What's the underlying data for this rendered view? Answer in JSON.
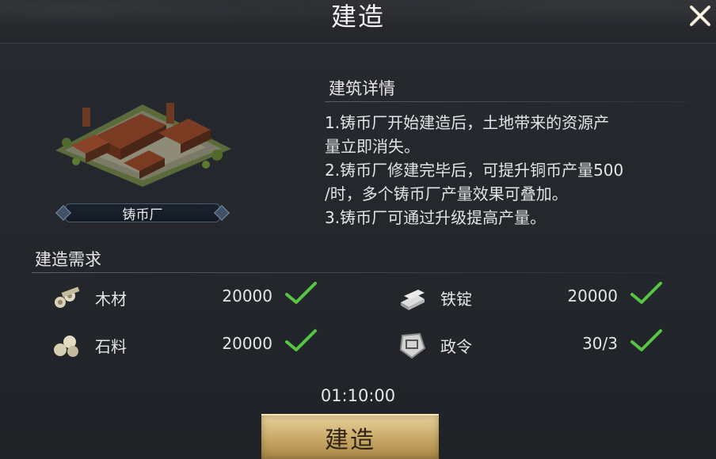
{
  "header": {
    "title": "建造",
    "close_icon": "close-x-icon"
  },
  "building": {
    "name": "铸币厂",
    "image_icon": "mint-building-illustration"
  },
  "detail": {
    "title": "建筑详情",
    "lines": [
      "1.铸币厂开始建造后，土地带来的资源产",
      "量立即消失。",
      "2.铸币厂修建完毕后，可提升铜币产量500",
      "/时，多个铸币厂产量效果可叠加。",
      "3.铸币厂可通过升级提高产量。"
    ]
  },
  "requirements": {
    "title": "建造需求",
    "items": [
      {
        "name": "木材",
        "amount": "20000",
        "icon": "wood-logs-icon",
        "met": true
      },
      {
        "name": "铁锭",
        "amount": "20000",
        "icon": "iron-ingot-icon",
        "met": true
      },
      {
        "name": "石料",
        "amount": "20000",
        "icon": "stone-icon",
        "met": true
      },
      {
        "name": "政令",
        "amount": "30/3",
        "icon": "decree-icon",
        "met": true
      }
    ]
  },
  "timer": "01:10:00",
  "build_button": {
    "label": "建造"
  },
  "colors": {
    "accent_gold": "#c7a765",
    "check_green": "#57c443",
    "background": "#23262b"
  }
}
